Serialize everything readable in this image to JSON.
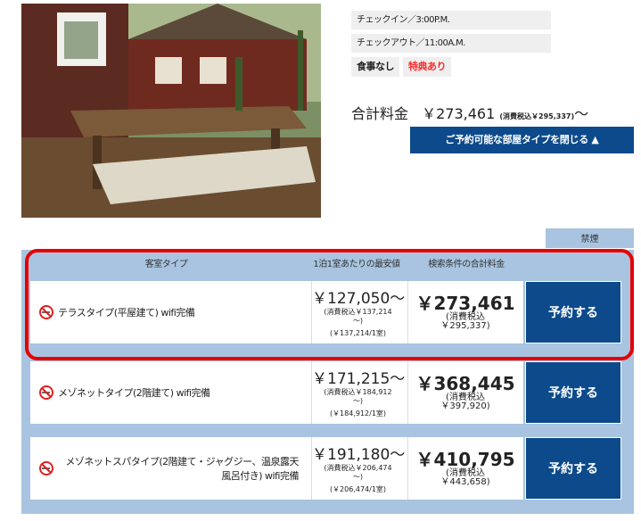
{
  "checkin": "チェックイン／3:00P.M.",
  "checkout": "チェックアウト／11:00A.M.",
  "tags": {
    "meal": "食事なし",
    "special": "特典あり"
  },
  "total": {
    "label": "合計料金",
    "price": "￥273,461",
    "tax": "(消費税込￥295,337)",
    "tilde": "〜"
  },
  "close_button": "ご予約可能な部屋タイプを閉じる ▲",
  "tab_label": "禁煙",
  "headers": {
    "room_type": "客室タイプ",
    "min_price": "1泊1室あたりの最安値",
    "total_price": "検索条件の合計料金"
  },
  "rooms": [
    {
      "name": "テラスタイプ(平屋建て) wifi完備",
      "price": "￥127,050〜",
      "price_tax": "(消費税込￥137,214",
      "price_tax2": "〜)",
      "per_room": "(￥137,214/1室)",
      "total": "￥273,461",
      "total_tax": "(消費税込",
      "total_tax2": "￥295,337)",
      "book": "予約する"
    },
    {
      "name": "メゾネットタイプ(2階建て) wifi完備",
      "price": "￥171,215〜",
      "price_tax": "(消費税込￥184,912",
      "price_tax2": "〜)",
      "per_room": "(￥184,912/1室)",
      "total": "￥368,445",
      "total_tax": "(消費税込",
      "total_tax2": "￥397,920)",
      "book": "予約する"
    },
    {
      "name": "メゾネットスパタイプ(2階建て・ジャグジー、温泉露天風呂付き) wifi完備",
      "price": "￥191,180〜",
      "price_tax": "(消費税込￥206,474",
      "price_tax2": "〜)",
      "per_room": "(￥206,474/1室)",
      "total": "￥410,795",
      "total_tax": "(消費税込",
      "total_tax2": "￥443,658)",
      "book": "予約する"
    }
  ],
  "colors": {
    "accent": "#0c4a8c",
    "table_bg": "#a8c4e0",
    "highlight": "#e80000",
    "special": "#ff2a2a"
  },
  "icons": {
    "no_smoking": "no-smoking-icon"
  }
}
